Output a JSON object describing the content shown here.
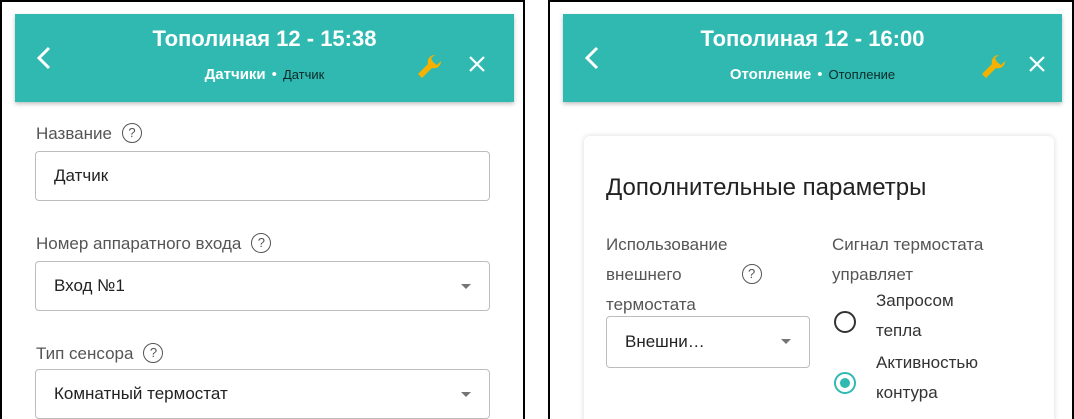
{
  "left": {
    "title": "Тополиная 12 - 15:38",
    "section": "Датчики",
    "separator": "•",
    "item": "Датчик",
    "name_label": "Название",
    "name_value": "Датчик",
    "input_label": "Номер аппаратного входа",
    "input_value": "Вход №1",
    "sensor_label": "Тип сенсора",
    "sensor_value": "Комнатный термостат",
    "help_glyph": "?"
  },
  "right": {
    "title": "Тополиная 12 - 16:00",
    "section": "Отопление",
    "separator": "•",
    "item": "Отопление",
    "card_title": "Дополнительные параметры",
    "ext_label_line1": "Использование",
    "ext_label_line2": "внешнего",
    "ext_label_line3": "термостата",
    "ext_value": "Внешни…",
    "signal_label_line1": "Сигнал термостата",
    "signal_label_line2": "управляет",
    "radio1_line1": "Запросом",
    "radio1_line2": "тепла",
    "radio1_selected": false,
    "radio2_line1": "Активностью",
    "radio2_line2": "контура",
    "radio2_selected": true,
    "help_glyph": "?"
  },
  "colors": {
    "header": "#2fb9b0",
    "wrench": "#f5b100",
    "accent": "#2fb9b0"
  },
  "icons": [
    "back-arrow-icon",
    "wrench-icon",
    "close-icon",
    "help-icon",
    "dropdown-caret-icon",
    "radio-icon"
  ]
}
